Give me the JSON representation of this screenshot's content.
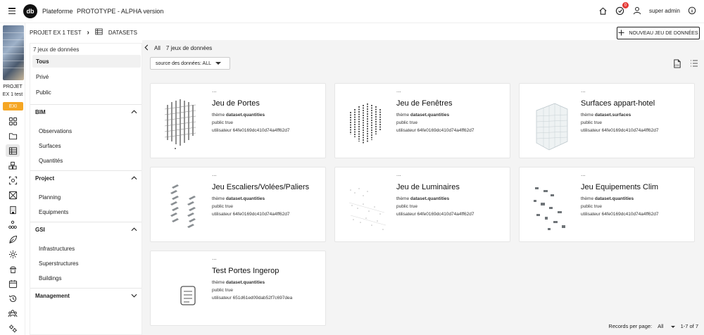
{
  "app": {
    "name": "Plateforme",
    "subtitle": "PROTOTYPE - ALPHA version",
    "logo_text": "db",
    "notification_count": "0",
    "user": "super admin"
  },
  "rail": {
    "project_label_1": "PROJET",
    "project_label_2": "EX 1 test",
    "ex_tag": "EXI"
  },
  "breadcrumb": {
    "project": "PROJET EX 1 TEST",
    "section": "DATASETS"
  },
  "new_dataset_label": "NOUVEAU JEU DE DONNÉES",
  "sidebar": {
    "count": "7 jeux de données",
    "visibility": [
      "Tous",
      "Privé",
      "Public"
    ],
    "groups": [
      {
        "label": "BIM",
        "items": [
          "Observations",
          "Surfaces",
          "Quantités"
        ]
      },
      {
        "label": "Project",
        "items": [
          "Planning",
          "Equipments"
        ]
      },
      {
        "label": "GSI",
        "items": [
          "Infrastructures",
          "Superstructures",
          "Buildings"
        ]
      },
      {
        "label": "Management",
        "items": []
      }
    ]
  },
  "content": {
    "back_all": "All",
    "count": "7 jeux de données",
    "source_filter": "source des données: ALL"
  },
  "cards": [
    {
      "dots": "...",
      "title": "Jeu de Portes",
      "theme_label": "thème",
      "theme": "dataset.quantities",
      "public": "public true",
      "user": "utilisateur 64fe0169dc410d74a4ff62d7"
    },
    {
      "dots": "...",
      "title": "Jeu de Fenêtres",
      "theme_label": "thème",
      "theme": "dataset.quantities",
      "public": "public true",
      "user": "utilisateur 64fe0169dc410d74a4ff62d7"
    },
    {
      "dots": "...",
      "title": "Surfaces appart-hotel",
      "theme_label": "thème",
      "theme": "dataset.surfaces",
      "public": "public true",
      "user": "utilisateur 64fe0169dc410d74a4ff62d7"
    },
    {
      "dots": "...",
      "title": "Jeu Escaliers/Volées/Paliers",
      "theme_label": "thème",
      "theme": "dataset.quantities",
      "public": "public true",
      "user": "utilisateur 64fe0169dc410d74a4ff62d7"
    },
    {
      "dots": "...",
      "title": "Jeu de Luminaires",
      "theme_label": "thème",
      "theme": "dataset.quantities",
      "public": "public true",
      "user": "utilisateur 64fe0169dc410d74a4ff62d7"
    },
    {
      "dots": "...",
      "title": "Jeu Equipements Clim",
      "theme_label": "thème",
      "theme": "dataset.quantities",
      "public": "public true",
      "user": "utilisateur 64fe0169dc410d74a4ff62d7"
    },
    {
      "dots": "...",
      "title": "Test Portes Ingerop",
      "theme_label": "thème",
      "theme": "dataset.quantities",
      "public": "public true",
      "user": "utilisateur 651d61ed09dab52f7c697dea"
    }
  ],
  "pagination": {
    "label": "Records per page:",
    "per_page": "All",
    "range": "1-7 of 7"
  }
}
